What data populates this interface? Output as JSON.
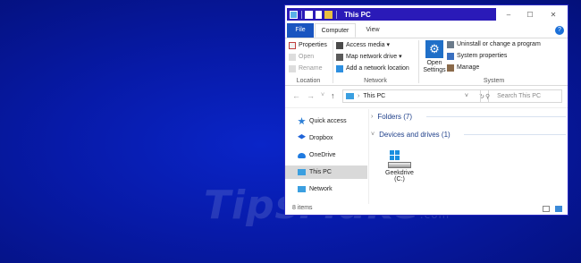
{
  "watermark": {
    "text": "TipsMake",
    "suffix": ".com"
  },
  "window": {
    "title": "This PC",
    "controls": {
      "minimize": "–",
      "maximize": "☐",
      "close": "✕"
    }
  },
  "ribbon_tabs": {
    "file": "File",
    "computer": "Computer",
    "view": "View",
    "help": "?"
  },
  "ribbon": {
    "location": {
      "label": "Location",
      "items": [
        "Properties",
        "Open",
        "Rename"
      ]
    },
    "network": {
      "label": "Network",
      "items": [
        "Access media ▾",
        "Map network drive ▾",
        "Add a network location"
      ]
    },
    "system": {
      "label": "System",
      "open_settings": "Open Settings",
      "items": [
        "Uninstall or change a program",
        "System properties",
        "Manage"
      ]
    }
  },
  "address_bar": {
    "back": "←",
    "forward": "→",
    "recent": "˅",
    "up": "↑",
    "path": "This PC",
    "dropdown": "˅",
    "refresh": "↻",
    "search_placeholder": "Search This PC"
  },
  "navigation_pane": {
    "items": [
      {
        "label": "Quick access",
        "icon": "star-icon",
        "color": "#2d7fd6",
        "selected": false
      },
      {
        "label": "Dropbox",
        "icon": "dropbox-icon",
        "color": "#1f64d8",
        "selected": false
      },
      {
        "label": "OneDrive",
        "icon": "cloud-icon",
        "color": "#1f7ae0",
        "selected": false
      },
      {
        "label": "This PC",
        "icon": "computer-icon",
        "color": "#3b9fe0",
        "selected": true
      },
      {
        "label": "Network",
        "icon": "network-icon",
        "color": "#3b9fe0",
        "selected": false
      }
    ]
  },
  "content": {
    "folders_header": "Folders (7)",
    "devices_header": "Devices and drives (1)",
    "drive": {
      "name": "Geekdrive",
      "letter": "(C:)"
    }
  },
  "status_bar": {
    "item_count": "8 items"
  },
  "colors": {
    "accent": "#1a55c0",
    "title_highlight": "#2a1ab8",
    "desktop": "#071aa8",
    "section_text": "#1e3f8a"
  }
}
